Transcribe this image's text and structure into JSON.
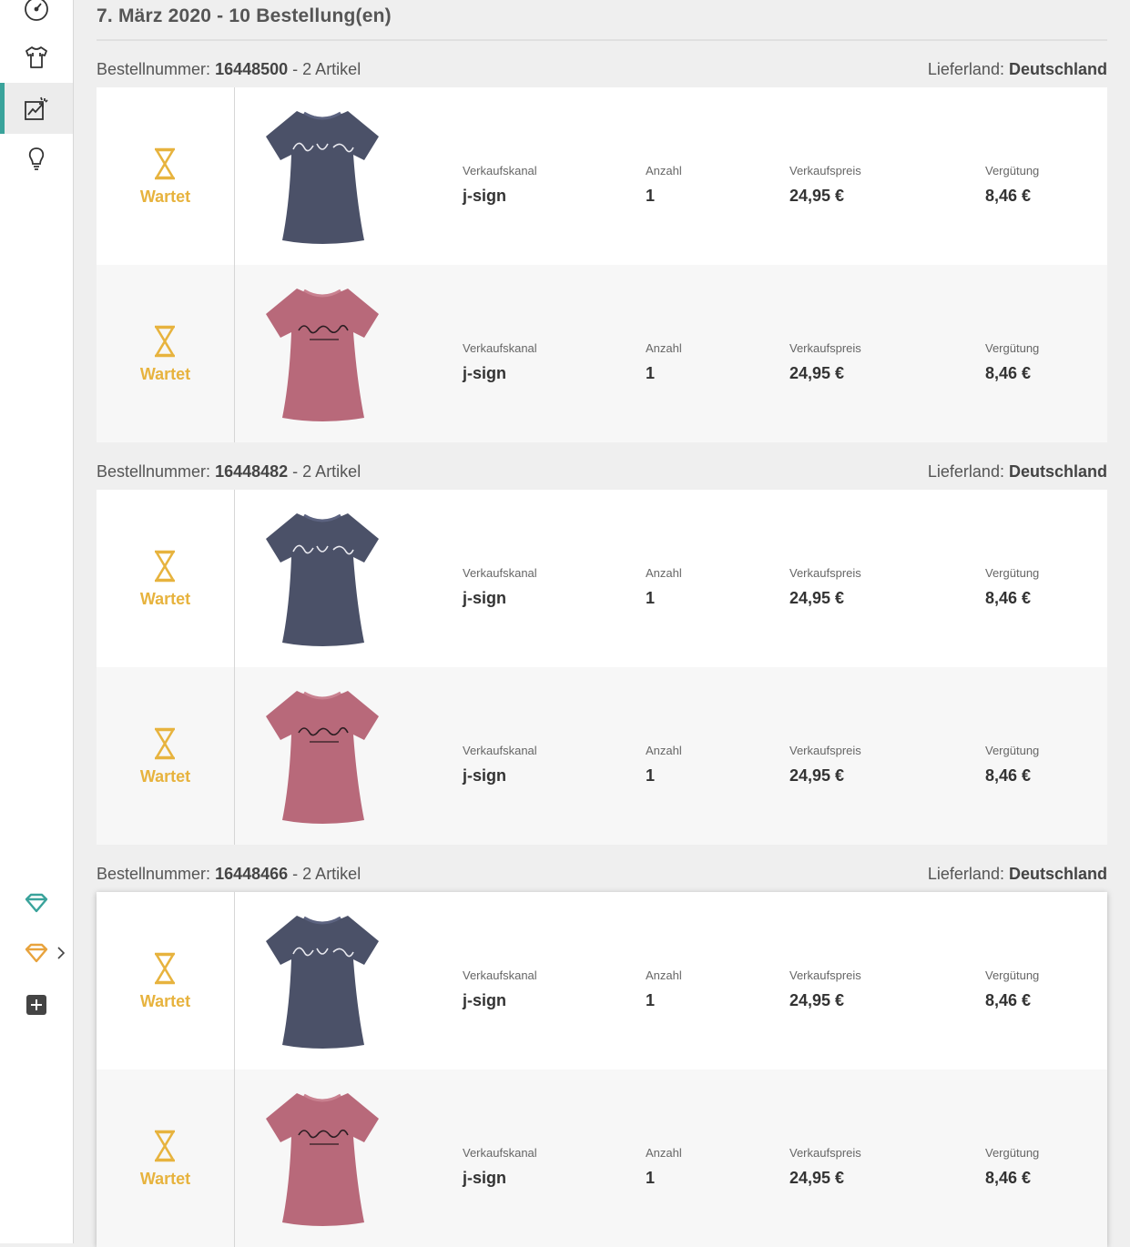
{
  "sidebar": {
    "items": [
      {
        "icon": "speedometer-icon"
      },
      {
        "icon": "tshirt-icon"
      },
      {
        "icon": "sales-chart-icon",
        "active": true
      },
      {
        "icon": "lightbulb-icon"
      }
    ],
    "bottom": [
      {
        "icon": "diamond-teal-icon",
        "color": "#3aa39b"
      },
      {
        "icon": "diamond-orange-icon",
        "color": "#e8a33d"
      },
      {
        "icon": "plus-square-icon",
        "color": "#444444"
      }
    ]
  },
  "day": {
    "title": "7. März 2020 - 10 Bestellung(en)"
  },
  "labels": {
    "order_number": "Bestellnummer:",
    "country": "Lieferland:",
    "channel": "Verkaufskanal",
    "quantity": "Anzahl",
    "price": "Verkaufspreis",
    "commission": "Vergütung",
    "status": "Wartet"
  },
  "colors": {
    "accent": "#3aa39b",
    "status": "#e7b33e",
    "shirt_navy": "#4b5168",
    "shirt_rose": "#b8697a"
  },
  "orders": [
    {
      "number": "16448500",
      "count": "- 2 Artikel",
      "country": "Deutschland",
      "items": [
        {
          "shirt": "navy",
          "status": "Wartet",
          "channel": "j-sign",
          "quantity": "1",
          "price": "24,95 €",
          "commission": "8,46 €"
        },
        {
          "shirt": "rose",
          "status": "Wartet",
          "channel": "j-sign",
          "quantity": "1",
          "price": "24,95 €",
          "commission": "8,46 €"
        }
      ]
    },
    {
      "number": "16448482",
      "count": "- 2 Artikel",
      "country": "Deutschland",
      "items": [
        {
          "shirt": "navy",
          "status": "Wartet",
          "channel": "j-sign",
          "quantity": "1",
          "price": "24,95 €",
          "commission": "8,46 €"
        },
        {
          "shirt": "rose",
          "status": "Wartet",
          "channel": "j-sign",
          "quantity": "1",
          "price": "24,95 €",
          "commission": "8,46 €"
        }
      ]
    },
    {
      "number": "16448466",
      "count": "- 2 Artikel",
      "country": "Deutschland",
      "items": [
        {
          "shirt": "navy",
          "status": "Wartet",
          "channel": "j-sign",
          "quantity": "1",
          "price": "24,95 €",
          "commission": "8,46 €"
        },
        {
          "shirt": "rose",
          "status": "Wartet",
          "channel": "j-sign",
          "quantity": "1",
          "price": "24,95 €",
          "commission": "8,46 €"
        }
      ]
    }
  ]
}
